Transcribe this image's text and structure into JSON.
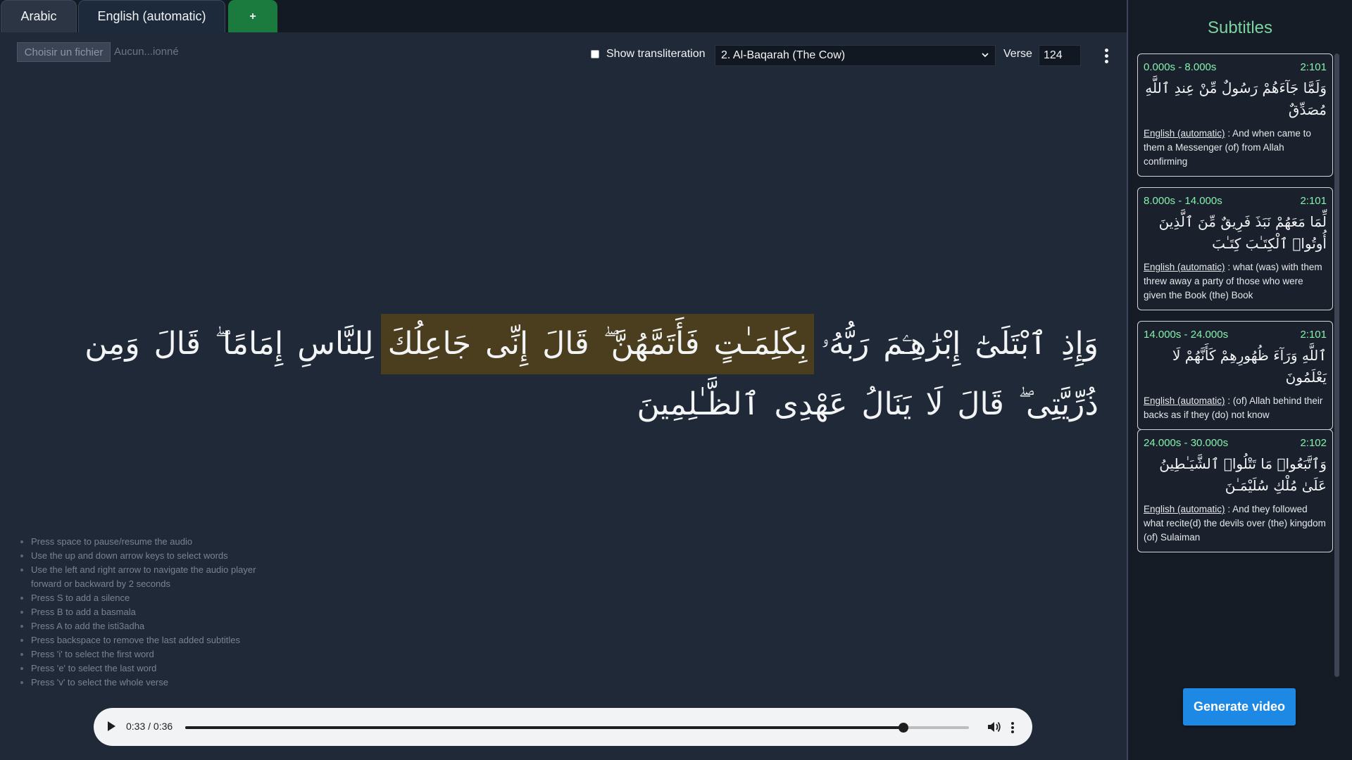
{
  "tabs": [
    {
      "label": "Arabic"
    },
    {
      "label": "English (automatic)"
    },
    {
      "label": "+"
    }
  ],
  "file_input": {
    "button_label": "Choisir un fichier",
    "status": "Aucun...ionné"
  },
  "toolbar": {
    "transliteration_label": "Show transliteration",
    "transliteration_checked": false,
    "surah_selected": "2. Al-Baqarah (The Cow)",
    "verse_label": "Verse",
    "verse_value": "124"
  },
  "verse": {
    "words": [
      {
        "text": "وَإِذِ",
        "selected": false
      },
      {
        "text": "ٱبْتَلَىٰٓ",
        "selected": false
      },
      {
        "text": "إِبْرَٰهِـۧمَ",
        "selected": false
      },
      {
        "text": "رَبُّهُۥ",
        "selected": false
      },
      {
        "text": "بِكَلِمَـٰتٍ",
        "selected": true
      },
      {
        "text": "فَأَتَمَّهُنَّ ۖ",
        "selected": true
      },
      {
        "text": "قَالَ",
        "selected": true
      },
      {
        "text": "إِنِّى",
        "selected": true
      },
      {
        "text": "جَاعِلُكَ",
        "selected": true
      },
      {
        "text": "لِلنَّاسِ",
        "selected": false
      },
      {
        "text": "إِمَامًا ۖ",
        "selected": false
      },
      {
        "text": "قَالَ",
        "selected": false
      },
      {
        "text": "وَمِن",
        "selected": false
      },
      {
        "text": "ذُرِّيَّتِى ۖ",
        "selected": false
      },
      {
        "text": "قَالَ",
        "selected": false
      },
      {
        "text": "لَا",
        "selected": false
      },
      {
        "text": "يَنَالُ",
        "selected": false
      },
      {
        "text": "عَهْدِى",
        "selected": false
      },
      {
        "text": "ٱلظَّـٰلِمِينَ",
        "selected": false
      }
    ]
  },
  "help": [
    "Press space to pause/resume the audio",
    "Use the up and down arrow keys to select words",
    "Use the left and right arrow to navigate the audio player forward or backward by 2 seconds",
    "Press S to add a silence",
    "Press B to add a basmala",
    "Press A to add the isti3adha",
    "Press backspace to remove the last added subtitles",
    "Press 'i' to select the first word",
    "Press 'e' to select the last word",
    "Press 'v' to select the whole verse"
  ],
  "player": {
    "time": "0:33 / 0:36",
    "progress": 0.9167
  },
  "sidebar": {
    "title": "Subtitles",
    "subtitles": [
      {
        "time": "0.000s - 8.000s",
        "ref": "2:101",
        "arabic": "وَلَمَّا جَآءَهُمْ رَسُولٌ مِّنْ عِندِ ٱللَّهِ مُصَدِّقٌ",
        "lang": "English (automatic)",
        "translation": " : And when came to them a Messenger (of) from Allah confirming"
      },
      {
        "time": "8.000s - 14.000s",
        "ref": "2:101",
        "arabic": "لِّمَا مَعَهُمْ نَبَذَ فَرِيقٌ مِّنَ ٱلَّذِينَ أُوتُوا۟ ٱلْكِتَـٰبَ كِتَـٰبَ",
        "lang": "English (automatic)",
        "translation": " : what (was) with them threw away a party of those who were given the Book (the) Book"
      },
      {
        "time": "14.000s - 24.000s",
        "ref": "2:101",
        "arabic": "ٱللَّهِ وَرَآءَ ظُهُورِهِمْ كَأَنَّهُمْ لَا يَعْلَمُونَ",
        "lang": "English (automatic)",
        "translation": " : (of) Allah behind their backs as if they (do) not know"
      },
      {
        "time": "24.000s - 30.000s",
        "ref": "2:102",
        "arabic": "وَٱتَّبَعُوا۟ مَا تَتْلُوا۟ ٱلشَّيَـٰطِينُ عَلَىٰ مُلْكِ سُلَيْمَـٰنَ",
        "lang": "English (automatic)",
        "translation": " : And they followed what recite(d) the devils over (the) kingdom (of) Sulaiman"
      }
    ],
    "generate_label": "Generate video"
  },
  "colors": {
    "accent_green": "#7dd3a0",
    "selection": "#4a3e1f",
    "button_blue": "#1e88e5",
    "add_tab_green": "#1b7a3e"
  }
}
